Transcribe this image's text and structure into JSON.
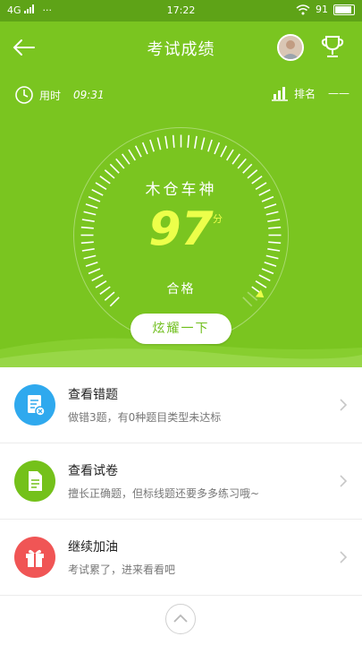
{
  "status_bar": {
    "network": "4G",
    "dots": "···",
    "time": "17:22",
    "battery_pct": "91"
  },
  "header": {
    "title": "考试成绩",
    "back_icon": "arrow-left-icon",
    "trophy_icon": "trophy-icon"
  },
  "meta": {
    "time_label": "用时",
    "time_value": "09:31",
    "rank_label": "排名",
    "rank_value": "——"
  },
  "result": {
    "username": "木仓车神",
    "score": "97",
    "score_unit": "分",
    "status": "合格",
    "share_label": "炫耀一下",
    "score_fraction": 0.97
  },
  "menu": [
    {
      "title": "查看错题",
      "subtitle": "做错3题，有0种题目类型未达标",
      "icon": "wrong-questions-icon",
      "color": "#2fa9ee"
    },
    {
      "title": "查看试卷",
      "subtitle": "擅长正确题，但标线题还要多多练习哦~",
      "icon": "paper-icon",
      "color": "#74c11a"
    },
    {
      "title": "继续加油",
      "subtitle": "考试累了，进来看看吧",
      "icon": "gift-icon",
      "color": "#f05555"
    }
  ],
  "colors": {
    "header_green": "#7ac520",
    "status_green": "#5ea317",
    "score_yellow": "#ecff4a"
  }
}
